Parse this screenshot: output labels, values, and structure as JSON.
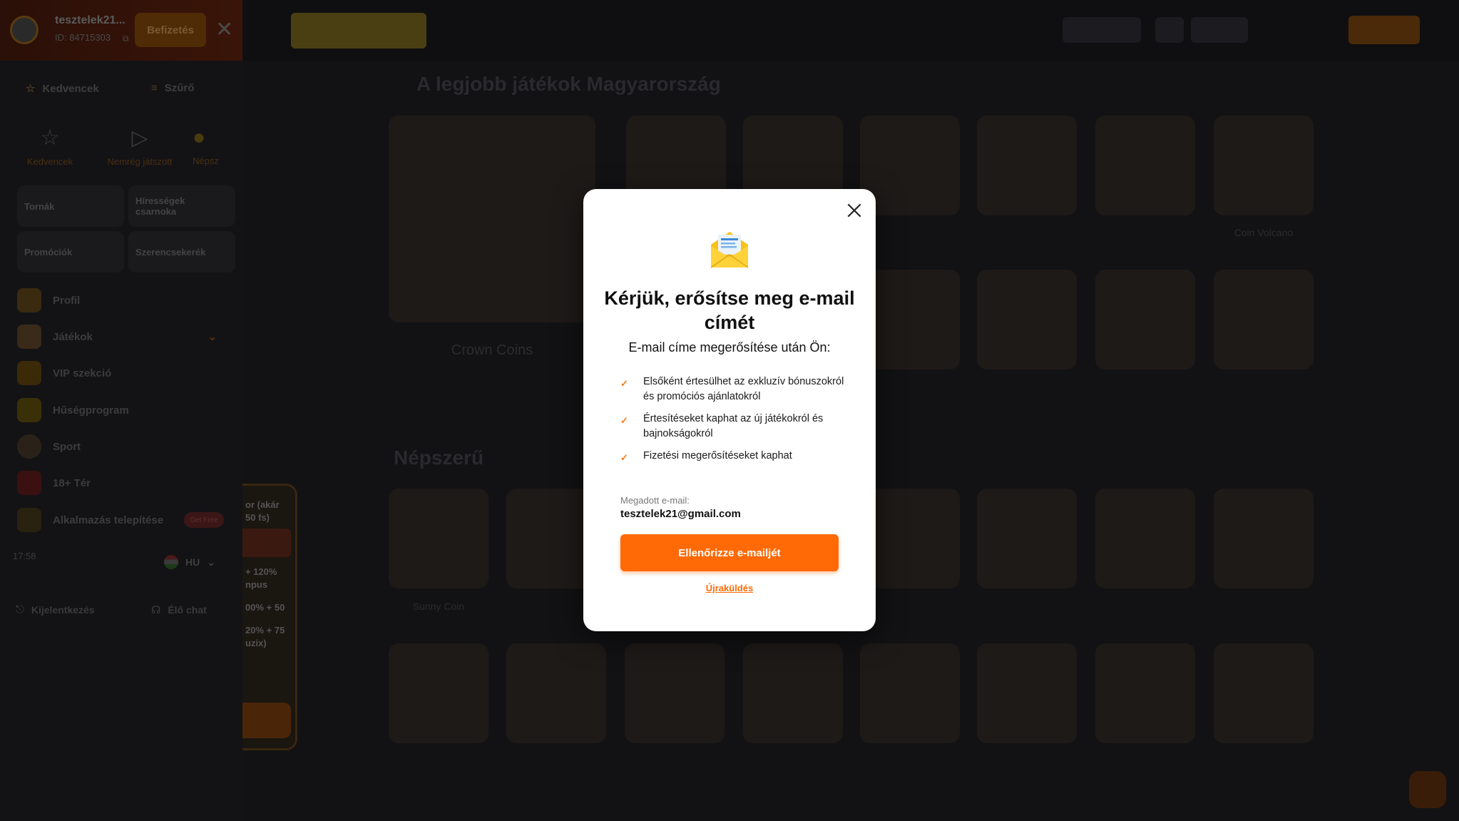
{
  "sidebar": {
    "username": "tesztelek21...",
    "user_id": "ID: 84715303",
    "deposit_label": "Befizetés",
    "favorites_label": "Kedvencek",
    "filter_label": "Szűrő",
    "tabs": [
      {
        "label": "Kedvencek",
        "icon": "star-icon"
      },
      {
        "label": "Nemrég játszott",
        "icon": "play-icon"
      },
      {
        "label": "Népsz",
        "icon": "popular-icon"
      }
    ],
    "cards": [
      "Tornák",
      "Hírességek csarnoka",
      "Promóciók",
      "Szerencsekerék"
    ],
    "menu": [
      {
        "label": "Profil",
        "icon": "profile-icon"
      },
      {
        "label": "Játékok",
        "icon": "games-icon"
      },
      {
        "label": "VIP szekció",
        "icon": "vip-icon"
      },
      {
        "label": "Hűségprogram",
        "icon": "loyalty-icon"
      },
      {
        "label": "Sport",
        "icon": "sport-icon"
      },
      {
        "label": "18+ Tér",
        "icon": "adult-icon"
      },
      {
        "label": "Alkalmazás telepítése",
        "icon": "app-icon"
      }
    ],
    "app_badge": "Get Free",
    "time_label": "17:58",
    "language": "HU",
    "logout_label": "Kijelentkezés",
    "live_chat_label": "Élő chat"
  },
  "background": {
    "section1_title": "A legjobb játékok Magyarország",
    "section2_title": "Népszerű",
    "featured_name": "Crown Coins",
    "row1_names": [
      "",
      "",
      "",
      "",
      "",
      "",
      "Coin Volcano"
    ],
    "row3_names": [
      "Sunny Coin",
      "",
      "",
      "",
      "",
      "",
      "",
      ""
    ],
    "promo_lines": [
      "or (akár",
      "50 fs)",
      "+ 120%",
      "npus",
      "00% + 50",
      "20% + 75",
      "uzix)"
    ]
  },
  "modal": {
    "title": "Kérjük, erősítse meg e-mail címét",
    "subtitle": "E-mail címe megerősítése után Ön:",
    "benefits": [
      "Elsőként értesülhet az exkluzív bónuszokról és promóciós ajánlatokról",
      "Értesítéseket kaphat az új játékokról és bajnokságokról",
      "Fizetési megerősítéseket kaphat"
    ],
    "email_label": "Megadott e-mail:",
    "email_value": "tesztelek21@gmail.com",
    "verify_button": "Ellenőrizze e-mailjét",
    "resend_link": "Újraküldés",
    "accent_color": "#ff6a06"
  }
}
